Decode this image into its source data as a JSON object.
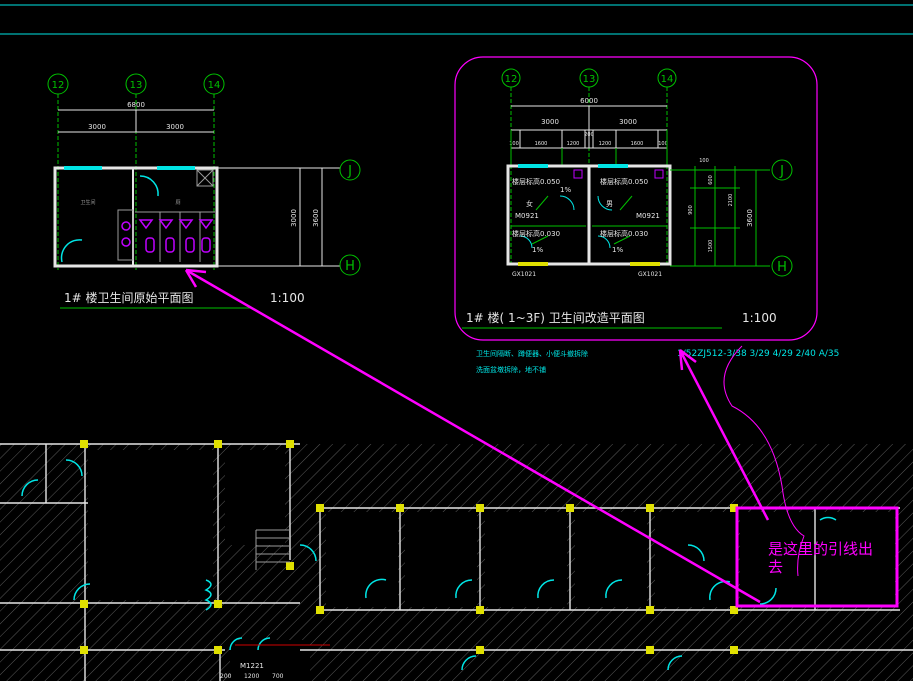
{
  "colors": {
    "background": "#000000",
    "cyan": "#00e5e5",
    "white": "#e6e6e6",
    "green": "#00c000",
    "magenta": "#ff00ff",
    "purple": "#c000ff",
    "yellow": "#e0e000",
    "red": "#d00000",
    "gray": "#9a9a9a"
  },
  "left_plan": {
    "grid_labels": [
      "12",
      "13",
      "14"
    ],
    "row_labels": [
      "J",
      "H"
    ],
    "dim_total": "6800",
    "dim_bays": [
      "3000",
      "3000"
    ],
    "dim_right": [
      "3000",
      "3600"
    ],
    "room_labels": [
      "卫生间",
      "厕"
    ],
    "title": "1# 楼卫生间原始平面图",
    "scale": "1:100"
  },
  "right_plan": {
    "grid_labels": [
      "12",
      "13",
      "14"
    ],
    "row_labels": [
      "J",
      "H"
    ],
    "dim_total": "6000",
    "dim_bays": [
      "3000",
      "3000"
    ],
    "dim_detail": [
      "100",
      "1600",
      "1200",
      "200",
      "1200",
      "1600",
      "100"
    ],
    "dim_center": "200",
    "dim_right_inner": [
      "100",
      "600",
      "900",
      "2100",
      "1500"
    ],
    "dim_right_outer": "3600",
    "room_texts": [
      "楼层标高0.050",
      "楼层标高0.050",
      "M0921",
      "M0921",
      "楼层标高0.030",
      "楼层标高0.030",
      "1%",
      "1%",
      "1%",
      "女",
      "男"
    ],
    "door_tags": [
      "GX1021",
      "GX1021"
    ],
    "title": "1# 楼(  1~3F)  卫生间改造平面图",
    "scale": "1:100",
    "notes": [
      "卫生间隔断、蹲便器、小便斗撤拆除",
      "洗面盆墩拆除，地不铺"
    ],
    "refs": "1/52ZJ512-3/38   3/29  4/29  2/40  A/35"
  },
  "annotation": {
    "text": "是这里的引线出去"
  },
  "lower_plan": {
    "door_tag": "M1221",
    "dims": [
      "200",
      "1200",
      "700"
    ]
  }
}
